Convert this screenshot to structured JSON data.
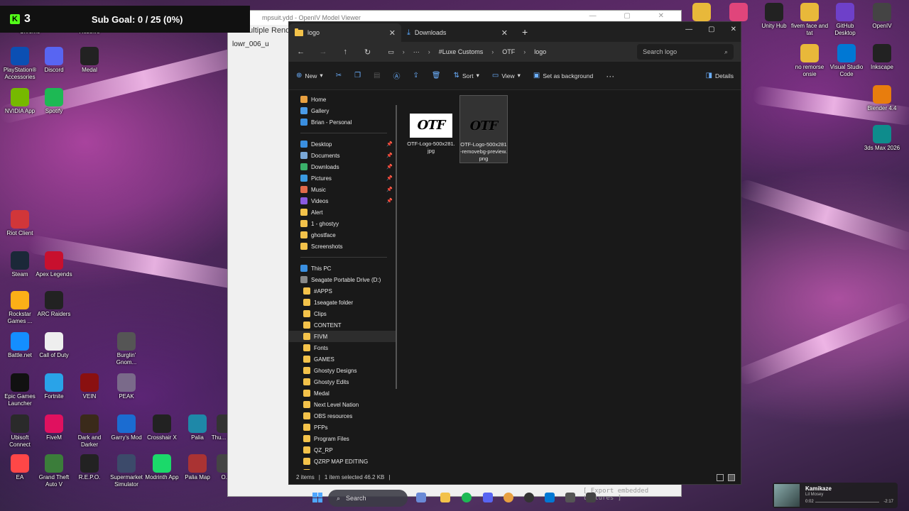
{
  "stream": {
    "kick_count": "3",
    "sub_goal": "Sub Goal: 0 / 25 (0%)",
    "brand_color": "#53fc18"
  },
  "desktop_left": [
    {
      "label": "Chrome",
      "color": "#2a6cd6"
    },
    {
      "label": "Resolve",
      "color": "#333344"
    },
    {
      "label": "PlayStation® Accessories",
      "color": "#0b4fb3"
    },
    {
      "label": "Discord",
      "color": "#5865f2"
    },
    {
      "label": "Medal",
      "color": "#222"
    },
    {
      "label": "NVIDIA App",
      "color": "#76b900"
    },
    {
      "label": "Spotify",
      "color": "#1db954"
    },
    {
      "label": "Riot Client",
      "color": "#d13639"
    },
    {
      "label": "Steam",
      "color": "#1b2838"
    },
    {
      "label": "Apex Legends",
      "color": "#c8102e"
    },
    {
      "label": "Rockstar Games ...",
      "color": "#fcaf17"
    },
    {
      "label": "ARC Raiders",
      "color": "#222"
    },
    {
      "label": "Battle.net",
      "color": "#148eff"
    },
    {
      "label": "Call of Duty",
      "color": "#eee"
    },
    {
      "label": "Burglin' Gnom...",
      "color": "#555"
    },
    {
      "label": "Epic Games Launcher",
      "color": "#111"
    },
    {
      "label": "Fortnite",
      "color": "#29a3e8"
    },
    {
      "label": "VEIN",
      "color": "#8a1010"
    },
    {
      "label": "PEAK",
      "color": "#7a6a8a"
    },
    {
      "label": "Ubisoft Connect",
      "color": "#2a2a2a"
    },
    {
      "label": "FiveM",
      "color": "#e0115f"
    },
    {
      "label": "Dark and Darker",
      "color": "#3a2a1a"
    },
    {
      "label": "Garry's Mod",
      "color": "#1b6cd1"
    },
    {
      "label": "Crosshair X",
      "color": "#222"
    },
    {
      "label": "Palia",
      "color": "#1e88a8"
    },
    {
      "label": "Thu... Mo...",
      "color": "#333"
    },
    {
      "label": "EA",
      "color": "#ff4747"
    },
    {
      "label": "Grand Theft Auto V",
      "color": "#3b7d3a"
    },
    {
      "label": "R.E.P.O.",
      "color": "#222"
    },
    {
      "label": "Supermarket Simulator",
      "color": "#3c4a6a"
    },
    {
      "label": "Modrinth App",
      "color": "#1bd96a"
    },
    {
      "label": "Palia Map",
      "color": "#a33"
    },
    {
      "label": "O...",
      "color": "#444"
    }
  ],
  "desktop_right": [
    {
      "label": "",
      "color": "#e8b83a"
    },
    {
      "label": "",
      "color": "#e0457b"
    },
    {
      "label": "Unity Hub",
      "color": "#222"
    },
    {
      "label": "fivem face and tat",
      "color": "#e8b83a"
    },
    {
      "label": "GitHub Desktop",
      "color": "#6e40c9"
    },
    {
      "label": "OpenIV",
      "color": "#444"
    },
    {
      "label": "no remorse onsie",
      "color": "#e8b83a"
    },
    {
      "label": "Visual Studio Code",
      "color": "#0078d4"
    },
    {
      "label": "Inkscape",
      "color": "#222"
    },
    {
      "label": "Blender 4.4",
      "color": "#e87d0d"
    },
    {
      "label": "3ds Max 2026",
      "color": "#0e8c8c"
    }
  ],
  "openiv": {
    "title": "mpsuit.ydd - OpenIV Model Viewer",
    "panel_label": "Multiple Rende",
    "item": "lowr_006_u",
    "export_label": "[ Export embedded textures ]"
  },
  "explorer": {
    "tabs": [
      {
        "label": "logo",
        "icon": "folder-icon"
      },
      {
        "label": "Downloads",
        "icon": "download-icon"
      }
    ],
    "breadcrumb": [
      "#Luxe Customs",
      "OTF",
      "logo"
    ],
    "search_placeholder": "Search logo",
    "commands": {
      "new": "New",
      "sort": "Sort",
      "view": "View",
      "set_bg": "Set as background",
      "details": "Details"
    },
    "nav": {
      "quick": [
        {
          "label": "Home",
          "color": "#e8a040"
        },
        {
          "label": "Gallery",
          "color": "#4a9be8"
        },
        {
          "label": "Brian - Personal",
          "color": "#3a8fe0"
        }
      ],
      "pinned": [
        {
          "label": "Desktop",
          "color": "#3a8fe0",
          "pinned": true
        },
        {
          "label": "Documents",
          "color": "#7aa8d8",
          "pinned": true
        },
        {
          "label": "Downloads",
          "color": "#3ab06a",
          "pinned": true
        },
        {
          "label": "Pictures",
          "color": "#3a9ae0",
          "pinned": true
        },
        {
          "label": "Music",
          "color": "#e06a4a",
          "pinned": true
        },
        {
          "label": "Videos",
          "color": "#8a5ae0",
          "pinned": true
        },
        {
          "label": "Alert",
          "color": "#f3c24a",
          "pinned": false
        },
        {
          "label": "1 - ghostyy",
          "color": "#f3c24a",
          "pinned": false
        },
        {
          "label": "ghostface",
          "color": "#f3c24a",
          "pinned": false
        },
        {
          "label": "Screenshots",
          "color": "#f3c24a",
          "pinned": false
        }
      ],
      "this_pc": "This PC",
      "drive": "Seagate Portable Drive (D:)",
      "drive_folders": [
        "#APPS",
        "1seagate folder",
        "Clips",
        "CONTENT",
        "FIVM",
        "Fonts",
        "GAMES",
        "Ghostyy Designs",
        "Ghostyy Edits",
        "Medal",
        "Next Level Nation",
        "OBS resources",
        "PFPs",
        "Program Files",
        "QZ_RP",
        "QZRP MAP EDITING",
        "shhhh"
      ],
      "selected_folder": "FIVM"
    },
    "files": [
      {
        "name": "OTF-Logo-500x281.jpg",
        "thumb_text": "OTF",
        "selected": false
      },
      {
        "name": "OTF-Logo-500x281-removebg-preview.png",
        "thumb_text": "OTF",
        "selected": true
      }
    ],
    "status": {
      "items": "2 items",
      "selected": "1 item selected  46.2 KB"
    }
  },
  "taskbar": {
    "search": "Search"
  },
  "media": {
    "song": "Kamikaze",
    "artist": "Lil Mosey",
    "elapsed": "0:02",
    "duration": "-2:17"
  }
}
